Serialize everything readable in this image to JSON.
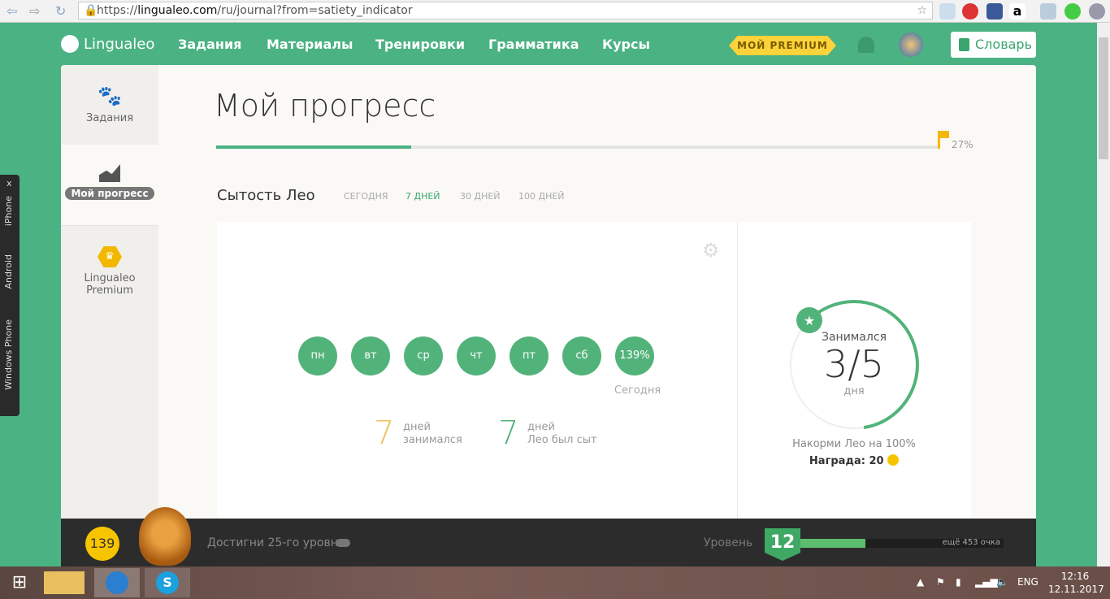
{
  "browser": {
    "url_prefix": "https://",
    "url_domain": "lingualeo.com",
    "url_path": "/ru/journal?from=satiety_indicator"
  },
  "header": {
    "logo": "Lingualeo",
    "menu": [
      "Задания",
      "Материалы",
      "Тренировки",
      "Грамматика",
      "Курсы"
    ],
    "premium": "МОЙ PREMIUM",
    "dictionary": "Словарь"
  },
  "mobile_bar": {
    "close": "x",
    "items": [
      "iPhone",
      "Android",
      "Windows Phone"
    ]
  },
  "sidebar": {
    "items": [
      {
        "label": "Задания",
        "icon": "paw-icon"
      },
      {
        "label": "Мой прогресс",
        "icon": "chart-icon",
        "active": true
      },
      {
        "label1": "Lingualeo",
        "label2": "Premium",
        "icon": "crown-icon"
      }
    ]
  },
  "main": {
    "title": "Мой прогресс",
    "progress_percent": 27,
    "progress_label": "27%",
    "section_title": "Сытость Лео",
    "tabs": [
      "СЕГОДНЯ",
      "7 ДНЕЙ",
      "30 ДНЕЙ",
      "100 ДНЕЙ"
    ],
    "active_tab": "7 ДНЕЙ",
    "days": [
      "пн",
      "вт",
      "ср",
      "чт",
      "пт",
      "сб",
      "139%"
    ],
    "today_label": "Сегодня",
    "stat1": {
      "value": "7",
      "line1": "дней",
      "line2": "занимался"
    },
    "stat2": {
      "value": "7",
      "line1": "дней",
      "line2": "Лео был сыт"
    },
    "goal": {
      "label": "Занимался",
      "value": "3/5",
      "unit": "дня",
      "fraction": 0.6,
      "hint": "Накорми Лео на 100%",
      "reward": "Награда: 20"
    }
  },
  "footer": {
    "coins": "139",
    "goal": "Достигни 25-го уровня",
    "level_label": "Уровень",
    "level": "12",
    "xp_fraction": 0.32,
    "xp_left": "ещё 453 очка"
  },
  "taskbar": {
    "lang": "ENG",
    "time": "12:16",
    "date": "12.11.2017"
  },
  "colors": {
    "brand": "#4bb283",
    "premium": "#fcd33a",
    "day": "#52b37a",
    "stat1": "#f0c060"
  }
}
